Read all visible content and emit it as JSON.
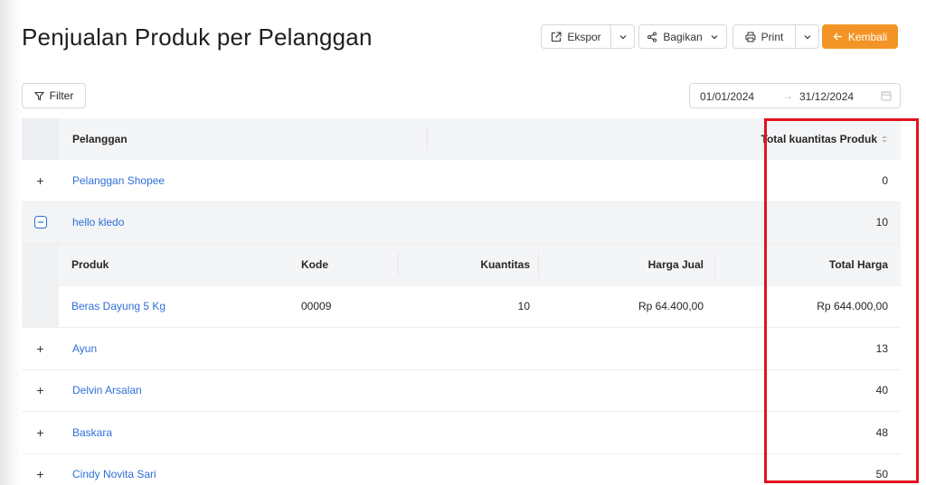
{
  "page": {
    "title": "Penjualan Produk per Pelanggan"
  },
  "toolbar": {
    "export_label": "Ekspor",
    "share_label": "Bagikan",
    "print_label": "Print",
    "back_label": "Kembali",
    "back_color": "#f39526"
  },
  "filter": {
    "label": "Filter"
  },
  "date_range": {
    "start": "01/01/2024",
    "end": "31/12/2024",
    "separator": "→"
  },
  "table": {
    "columns": {
      "customer": "Pelanggan",
      "total_qty": "Total kuantitas Produk"
    },
    "rows": [
      {
        "customer": "Pelanggan Shopee",
        "total_qty": "0"
      },
      {
        "customer": "hello kledo",
        "total_qty": "10"
      },
      {
        "customer": "Ayun",
        "total_qty": "13"
      },
      {
        "customer": "Delvin Arsalan",
        "total_qty": "40"
      },
      {
        "customer": "Baskara",
        "total_qty": "48"
      },
      {
        "customer": "Cindy Novita Sari",
        "total_qty": "50"
      }
    ],
    "sub_columns": {
      "product": "Produk",
      "code": "Kode",
      "quantity": "Kuantitas",
      "price": "Harga Jual",
      "total_price": "Total Harga"
    },
    "sub_rows": [
      {
        "product": "Beras Dayung 5 Kg",
        "code": "00009",
        "quantity": "10",
        "price": "Rp 64.400,00",
        "total_price": "Rp 644.000,00"
      }
    ]
  },
  "highlight": {
    "color": "#e0141e"
  }
}
